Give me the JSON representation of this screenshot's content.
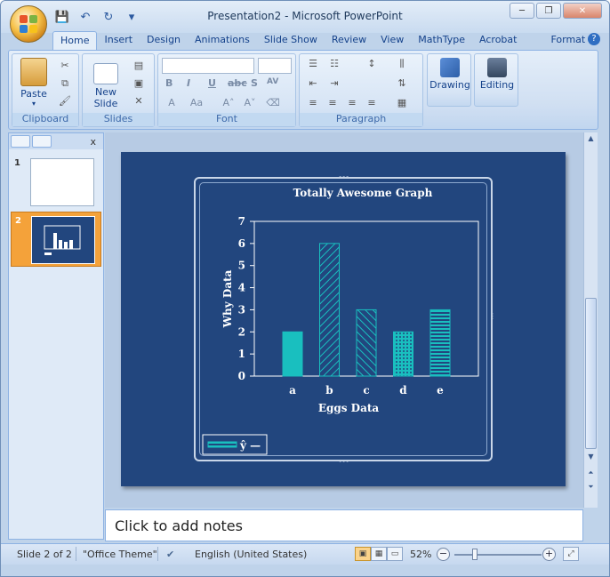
{
  "window": {
    "title": "Presentation2 - Microsoft PowerPoint",
    "minimize": "─",
    "restore": "❐",
    "close": "✕"
  },
  "qat": {
    "save": "💾",
    "undo": "↶",
    "redo": "↻",
    "customize": "▾"
  },
  "ribbon_tabs": [
    "Home",
    "Insert",
    "Design",
    "Animations",
    "Slide Show",
    "Review",
    "View",
    "MathType",
    "Acrobat",
    "Format"
  ],
  "active_tab": "Home",
  "help": "?",
  "ribbon": {
    "groups": {
      "clipboard": "Clipboard",
      "slides": "Slides",
      "font": "Font",
      "paragraph": "Paragraph",
      "drawing": "Drawing",
      "editing": "Editing"
    },
    "paste_label": "Paste",
    "new_slide_label_1": "New",
    "new_slide_label_2": "Slide",
    "drawing_label": "Drawing",
    "editing_label": "Editing",
    "font_format_chars": [
      "B",
      "I",
      "U",
      "abc",
      "S",
      "AV"
    ]
  },
  "thumbnails": {
    "close": "x",
    "slides": [
      {
        "number": "1"
      },
      {
        "number": "2"
      }
    ]
  },
  "chart_data": {
    "type": "bar",
    "title": "Totally Awesome Graph",
    "xlabel": "Eggs Data",
    "ylabel": "Why Data",
    "categories": [
      "a",
      "b",
      "c",
      "d",
      "e"
    ],
    "values": [
      2,
      6,
      3,
      2,
      3
    ],
    "ylim": [
      0,
      7
    ],
    "yticks": [
      "0",
      "1",
      "2",
      "3",
      "4",
      "5",
      "6",
      "7"
    ],
    "bar_fills": [
      "solid",
      "diagonal",
      "diagonal-back",
      "dots",
      "horizontal"
    ],
    "bar_color": "#19bfbf",
    "background": "#22467e",
    "legend": {
      "label": "ŷ —",
      "placement": "bottom-left"
    }
  },
  "notes": {
    "placeholder": "Click to add notes"
  },
  "status": {
    "slide_info": "Slide 2 of 2",
    "theme": "\"Office Theme\"",
    "language": "English (United States)",
    "zoom": "52%",
    "zoom_minus": "−",
    "zoom_plus": "+"
  }
}
